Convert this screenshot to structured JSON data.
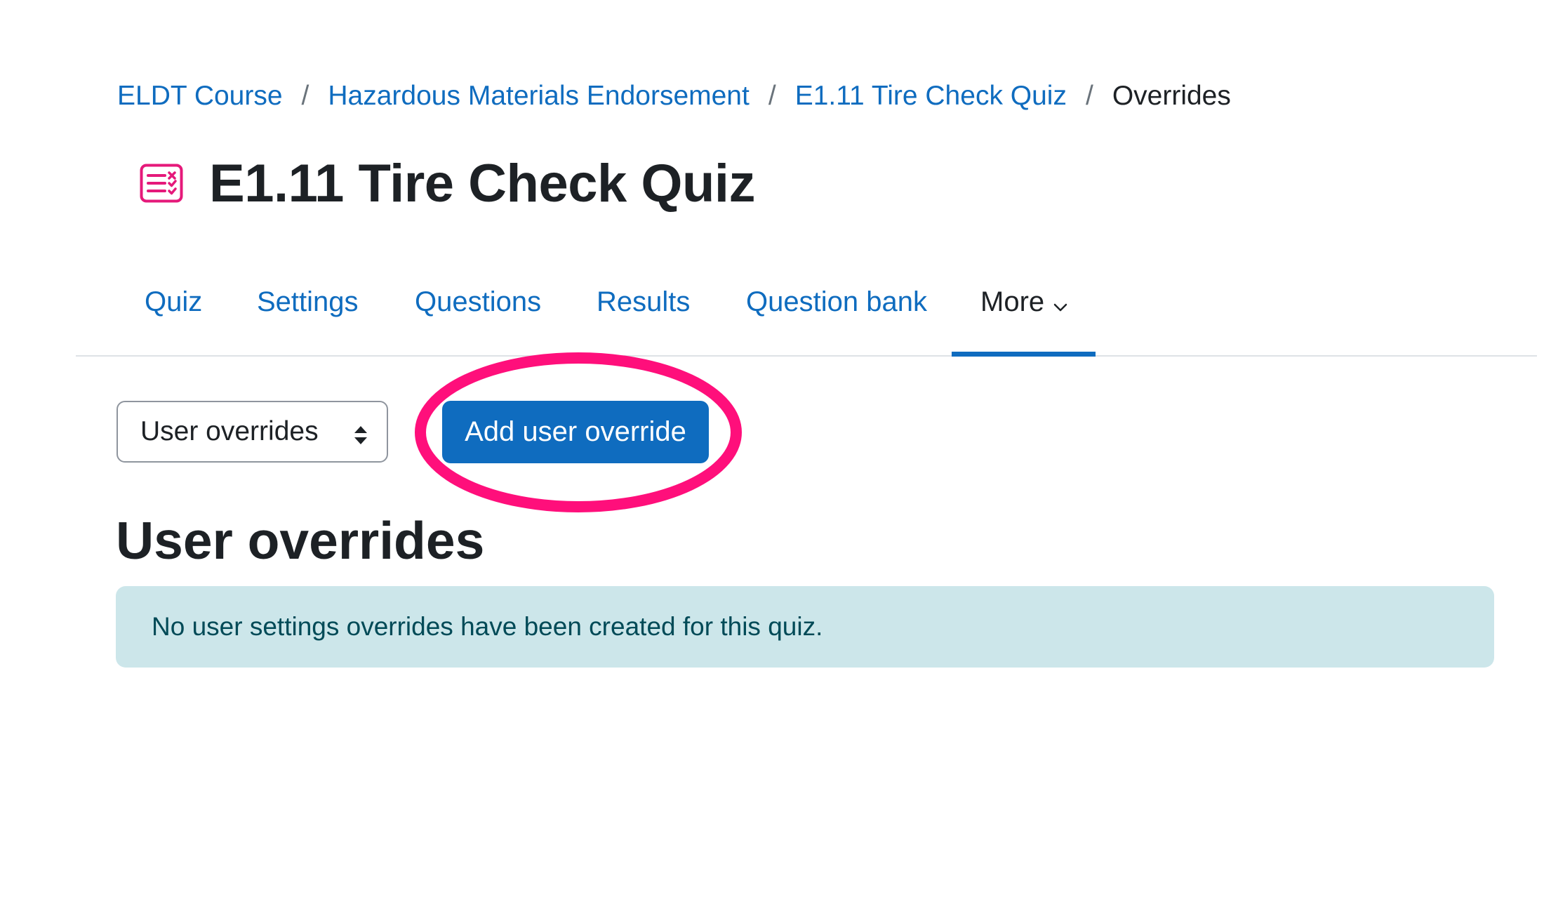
{
  "breadcrumb": {
    "items": [
      {
        "label": "ELDT Course"
      },
      {
        "label": "Hazardous Materials Endorsement"
      },
      {
        "label": "E1.11 Tire Check Quiz"
      }
    ],
    "current": "Overrides",
    "separator": "/"
  },
  "page": {
    "title": "E1.11 Tire Check Quiz",
    "icon": "quiz-checklist-icon",
    "icon_color": "#e5197a"
  },
  "nav": {
    "tabs": [
      {
        "label": "Quiz"
      },
      {
        "label": "Settings"
      },
      {
        "label": "Questions"
      },
      {
        "label": "Results"
      },
      {
        "label": "Question bank"
      }
    ],
    "more_label": "More",
    "active_tab": "More"
  },
  "overrides": {
    "select_value": "User overrides",
    "add_button_label": "Add user override",
    "heading": "User overrides",
    "empty_message": "No user settings overrides have been created for this quiz."
  },
  "colors": {
    "link": "#0f6cbf",
    "primary": "#0f6cbf",
    "highlight": "#ff0f7b",
    "alert_bg": "#cce6ea",
    "alert_text": "#004a57"
  }
}
